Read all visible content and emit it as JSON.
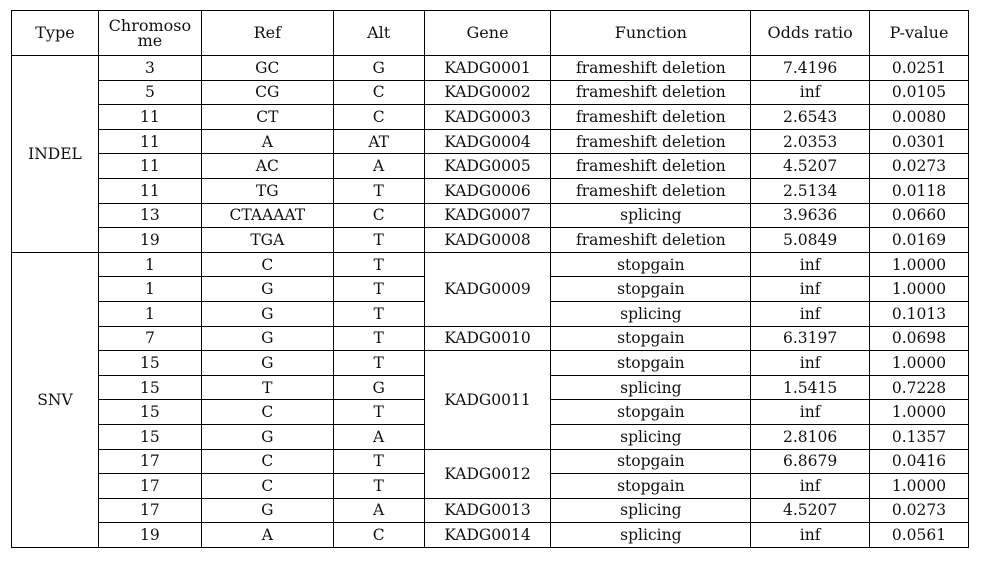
{
  "table": {
    "headers": {
      "type": "Type",
      "chromosome": "Chromoso me",
      "ref": "Ref",
      "alt": "Alt",
      "gene": "Gene",
      "function": "Function",
      "odds_ratio": "Odds ratio",
      "p_value": "P-value"
    },
    "groups": [
      {
        "type": "INDEL",
        "rows": [
          {
            "chromosome": "3",
            "ref": "GC",
            "alt": "G",
            "gene": "KADG0001",
            "function": "frameshift deletion",
            "odds_ratio": "7.4196",
            "p_value": "0.0251"
          },
          {
            "chromosome": "5",
            "ref": "CG",
            "alt": "C",
            "gene": "KADG0002",
            "function": "frameshift deletion",
            "odds_ratio": "inf",
            "p_value": "0.0105"
          },
          {
            "chromosome": "11",
            "ref": "CT",
            "alt": "C",
            "gene": "KADG0003",
            "function": "frameshift deletion",
            "odds_ratio": "2.6543",
            "p_value": "0.0080"
          },
          {
            "chromosome": "11",
            "ref": "A",
            "alt": "AT",
            "gene": "KADG0004",
            "function": "frameshift deletion",
            "odds_ratio": "2.0353",
            "p_value": "0.0301"
          },
          {
            "chromosome": "11",
            "ref": "AC",
            "alt": "A",
            "gene": "KADG0005",
            "function": "frameshift deletion",
            "odds_ratio": "4.5207",
            "p_value": "0.0273"
          },
          {
            "chromosome": "11",
            "ref": "TG",
            "alt": "T",
            "gene": "KADG0006",
            "function": "frameshift deletion",
            "odds_ratio": "2.5134",
            "p_value": "0.0118"
          },
          {
            "chromosome": "13",
            "ref": "CTAAAAT",
            "alt": "C",
            "gene": "KADG0007",
            "function": "splicing",
            "odds_ratio": "3.9636",
            "p_value": "0.0660"
          },
          {
            "chromosome": "19",
            "ref": "TGA",
            "alt": "T",
            "gene": "KADG0008",
            "function": "frameshift deletion",
            "odds_ratio": "5.0849",
            "p_value": "0.0169"
          }
        ]
      },
      {
        "type": "SNV",
        "rows": [
          {
            "chromosome": "1",
            "ref": "C",
            "alt": "T",
            "gene": "KADG0009",
            "gene_span": 3,
            "function": "stopgain",
            "odds_ratio": "inf",
            "p_value": "1.0000"
          },
          {
            "chromosome": "1",
            "ref": "G",
            "alt": "T",
            "function": "stopgain",
            "odds_ratio": "inf",
            "p_value": "1.0000"
          },
          {
            "chromosome": "1",
            "ref": "G",
            "alt": "T",
            "function": "splicing",
            "odds_ratio": "inf",
            "p_value": "0.1013"
          },
          {
            "chromosome": "7",
            "ref": "G",
            "alt": "T",
            "gene": "KADG0010",
            "gene_span": 1,
            "function": "stopgain",
            "odds_ratio": "6.3197",
            "p_value": "0.0698"
          },
          {
            "chromosome": "15",
            "ref": "G",
            "alt": "T",
            "gene": "KADG0011",
            "gene_span": 4,
            "function": "stopgain",
            "odds_ratio": "inf",
            "p_value": "1.0000"
          },
          {
            "chromosome": "15",
            "ref": "T",
            "alt": "G",
            "function": "splicing",
            "odds_ratio": "1.5415",
            "p_value": "0.7228"
          },
          {
            "chromosome": "15",
            "ref": "C",
            "alt": "T",
            "function": "stopgain",
            "odds_ratio": "inf",
            "p_value": "1.0000"
          },
          {
            "chromosome": "15",
            "ref": "G",
            "alt": "A",
            "function": "splicing",
            "odds_ratio": "2.8106",
            "p_value": "0.1357"
          },
          {
            "chromosome": "17",
            "ref": "C",
            "alt": "T",
            "gene": "KADG0012",
            "gene_span": 2,
            "function": "stopgain",
            "odds_ratio": "6.8679",
            "p_value": "0.0416"
          },
          {
            "chromosome": "17",
            "ref": "C",
            "alt": "T",
            "function": "stopgain",
            "odds_ratio": "inf",
            "p_value": "1.0000"
          },
          {
            "chromosome": "17",
            "ref": "G",
            "alt": "A",
            "gene": "KADG0013",
            "gene_span": 1,
            "function": "splicing",
            "odds_ratio": "4.5207",
            "p_value": "0.0273"
          },
          {
            "chromosome": "19",
            "ref": "A",
            "alt": "C",
            "gene": "KADG0014",
            "gene_span": 1,
            "function": "splicing",
            "odds_ratio": "inf",
            "p_value": "0.0561"
          }
        ]
      }
    ]
  }
}
